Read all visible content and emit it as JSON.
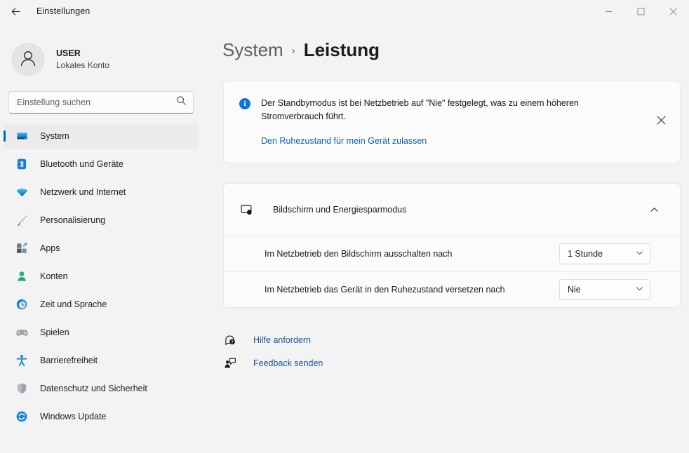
{
  "window": {
    "title": "Einstellungen",
    "back_icon": "arrow-left-icon",
    "controls": [
      {
        "name": "minimize",
        "icon": "minimize-icon"
      },
      {
        "name": "maximize",
        "icon": "maximize-icon"
      },
      {
        "name": "close",
        "icon": "close-icon"
      }
    ]
  },
  "sidebar": {
    "account": {
      "name": "USER",
      "subtitle": "Lokales Konto",
      "avatar_icon": "person-avatar-icon"
    },
    "search": {
      "placeholder": "Einstellung suchen",
      "icon": "search-icon"
    },
    "items": [
      {
        "label": "System",
        "icon": "monitor-icon",
        "selected": true
      },
      {
        "label": "Bluetooth und Geräte",
        "icon": "bluetooth-icon",
        "selected": false
      },
      {
        "label": "Netzwerk und Internet",
        "icon": "wifi-icon",
        "selected": false
      },
      {
        "label": "Personalisierung",
        "icon": "paintbrush-icon",
        "selected": false
      },
      {
        "label": "Apps",
        "icon": "apps-grid-icon",
        "selected": false
      },
      {
        "label": "Konten",
        "icon": "person-icon",
        "selected": false
      },
      {
        "label": "Zeit und Sprache",
        "icon": "clock-icon",
        "selected": false
      },
      {
        "label": "Spielen",
        "icon": "gamepad-icon",
        "selected": false
      },
      {
        "label": "Barrierefreiheit",
        "icon": "accessibility-icon",
        "selected": false
      },
      {
        "label": "Datenschutz und Sicherheit",
        "icon": "shield-icon",
        "selected": false
      },
      {
        "label": "Windows Update",
        "icon": "refresh-icon",
        "selected": false
      }
    ]
  },
  "main": {
    "breadcrumb": {
      "parent": "System",
      "separator": "›",
      "current": "Leistung"
    },
    "banner": {
      "icon": "info-icon",
      "glyph": "i",
      "text": "Der Standbymodus ist bei Netzbetrieb auf \"Nie\" festgelegt, was zu einem höheren Stromverbrauch führt.",
      "link": "Den Ruhezustand für mein Gerät zulassen",
      "close_icon": "close-icon"
    },
    "card": {
      "icon": "display-power-icon",
      "title": "Bildschirm und Energiesparmodus",
      "chevron_icon": "chevron-up-icon",
      "expanded": true,
      "rows": [
        {
          "label": "Im Netzbetrieb den Bildschirm ausschalten nach",
          "value": "1 Stunde",
          "chevron_icon": "chevron-down-icon"
        },
        {
          "label": "Im Netzbetrieb das Gerät in den Ruhezustand versetzen nach",
          "value": "Nie",
          "chevron_icon": "chevron-down-icon"
        }
      ]
    },
    "help_links": [
      {
        "label": "Hilfe anfordern",
        "icon": "help-question-icon"
      },
      {
        "label": "Feedback senden",
        "icon": "feedback-icon"
      }
    ]
  },
  "colors": {
    "accent": "#0067c0",
    "link": "#19559e",
    "banner_link": "#0e62b6",
    "info_blue": "#0c74d4",
    "page_bg": "#f3f3f3",
    "card_bg": "#fbfbfb"
  }
}
